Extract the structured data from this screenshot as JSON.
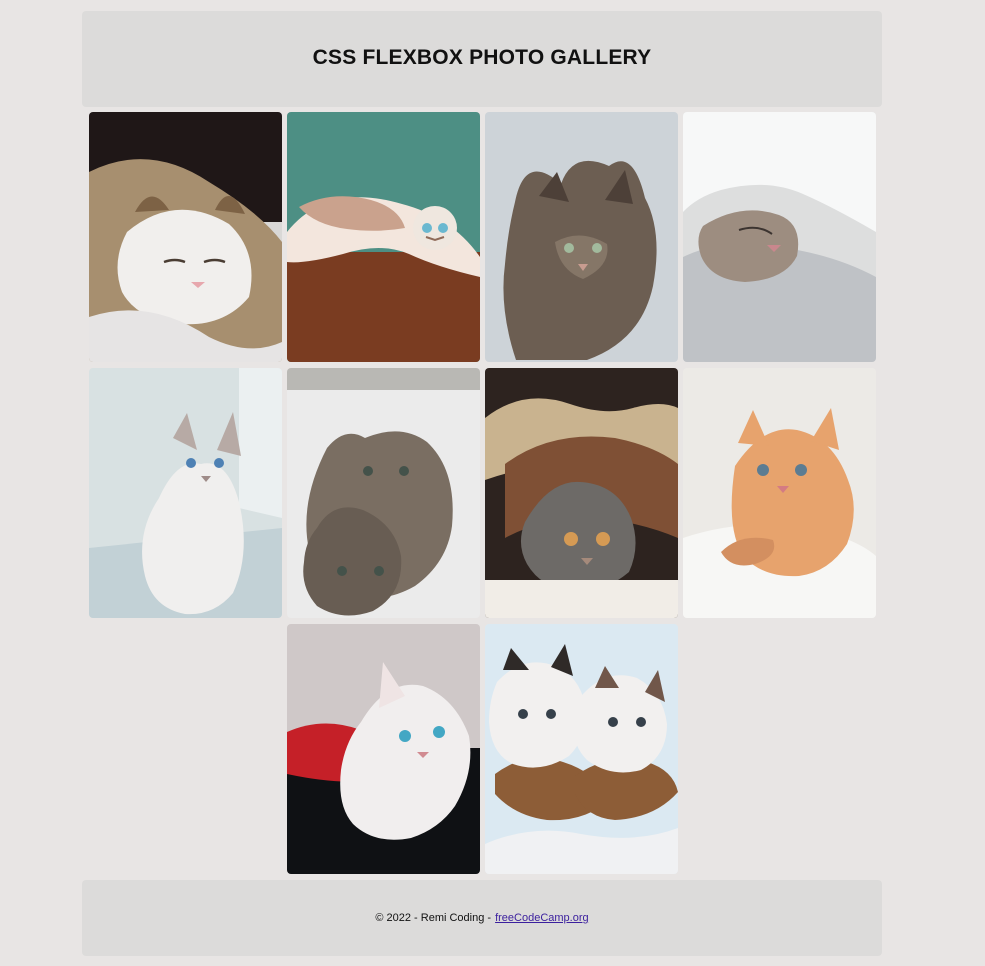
{
  "header": {
    "title": "CSS FLEXBOX PHOTO GALLERY"
  },
  "gallery": {
    "photos": [
      {
        "name": "sleeping-kitten",
        "alt": "sleeping tabby and white kitten"
      },
      {
        "name": "lying-kitten",
        "alt": "kitten lying upside down on wooden floor"
      },
      {
        "name": "gray-tabby-cat",
        "alt": "long-haired gray tabby cat"
      },
      {
        "name": "kitten-under-blanket",
        "alt": "kitten sleeping under white blanket"
      },
      {
        "name": "white-siamese-kitten",
        "alt": "white siamese kitten by window"
      },
      {
        "name": "two-tabby-kittens",
        "alt": "two tabby kittens"
      },
      {
        "name": "cat-under-pillow",
        "alt": "tabby cat hiding under fluffy pillow"
      },
      {
        "name": "orange-kitten",
        "alt": "orange kitten lying down"
      },
      {
        "name": "white-kitten-blue-eyes",
        "alt": "white kitten with blue eyes on red fabric"
      },
      {
        "name": "kittens-in-basket",
        "alt": "two kittens in a wicker basket"
      }
    ]
  },
  "footer": {
    "copyright": "© 2022 - Remi Coding - ",
    "link_text": "freeCodeCamp.org"
  },
  "colors": {
    "page_background": "#e8e5e4",
    "panel_background": "#dcdbda",
    "link": "#3b1f9e"
  }
}
